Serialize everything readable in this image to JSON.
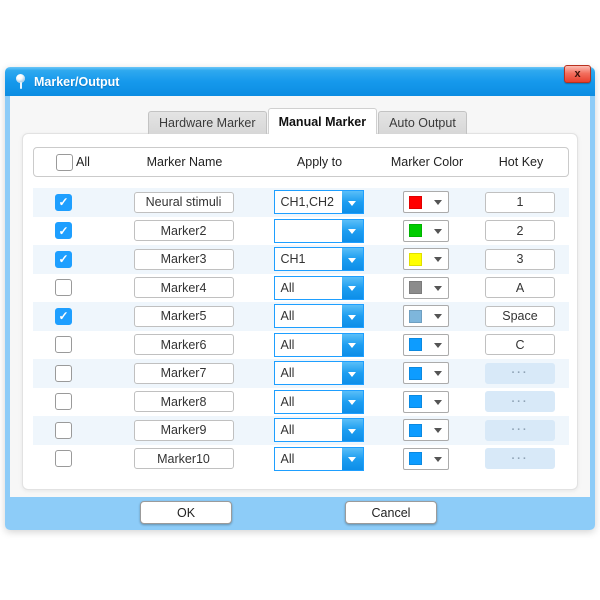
{
  "window": {
    "title": "Marker/Output",
    "close_label": "x"
  },
  "tabs": [
    {
      "label": "Hardware Marker",
      "active": false
    },
    {
      "label": "Manual Marker",
      "active": true
    },
    {
      "label": "Auto Output",
      "active": false
    }
  ],
  "table": {
    "headers": {
      "all": "All",
      "marker_name": "Marker Name",
      "apply_to": "Apply to",
      "marker_color": "Marker Color",
      "hot_key": "Hot Key"
    },
    "all_checked": false,
    "rows": [
      {
        "checked": true,
        "name": "Neural stimuli",
        "apply_to": "CH1,CH2",
        "color": "#ff0000",
        "hot_key": "1",
        "hot_key_enabled": true
      },
      {
        "checked": true,
        "name": "Marker2",
        "apply_to": "",
        "color": "#00cc00",
        "hot_key": "2",
        "hot_key_enabled": true
      },
      {
        "checked": true,
        "name": "Marker3",
        "apply_to": "CH1",
        "color": "#ffff00",
        "hot_key": "3",
        "hot_key_enabled": true
      },
      {
        "checked": false,
        "name": "Marker4",
        "apply_to": "All",
        "color": "#8c8c8c",
        "hot_key": "A",
        "hot_key_enabled": true
      },
      {
        "checked": true,
        "name": "Marker5",
        "apply_to": "All",
        "color": "#7eb6dc",
        "hot_key": "Space",
        "hot_key_enabled": true
      },
      {
        "checked": false,
        "name": "Marker6",
        "apply_to": "All",
        "color": "#0d9cff",
        "hot_key": "C",
        "hot_key_enabled": true
      },
      {
        "checked": false,
        "name": "Marker7",
        "apply_to": "All",
        "color": "#0d9cff",
        "hot_key": "···",
        "hot_key_enabled": false
      },
      {
        "checked": false,
        "name": "Marker8",
        "apply_to": "All",
        "color": "#0d9cff",
        "hot_key": "···",
        "hot_key_enabled": false
      },
      {
        "checked": false,
        "name": "Marker9",
        "apply_to": "All",
        "color": "#0d9cff",
        "hot_key": "···",
        "hot_key_enabled": false
      },
      {
        "checked": false,
        "name": "Marker10",
        "apply_to": "All",
        "color": "#0d9cff",
        "hot_key": "···",
        "hot_key_enabled": false
      }
    ]
  },
  "footer": {
    "ok_label": "OK",
    "cancel_label": "Cancel"
  },
  "colors": {
    "accent": "#1e9fff",
    "frame": "#8dccf8",
    "row_stripe": "#eff6fc",
    "titlebar_top": "#2fa9ef",
    "titlebar_bottom": "#0c8de2"
  }
}
